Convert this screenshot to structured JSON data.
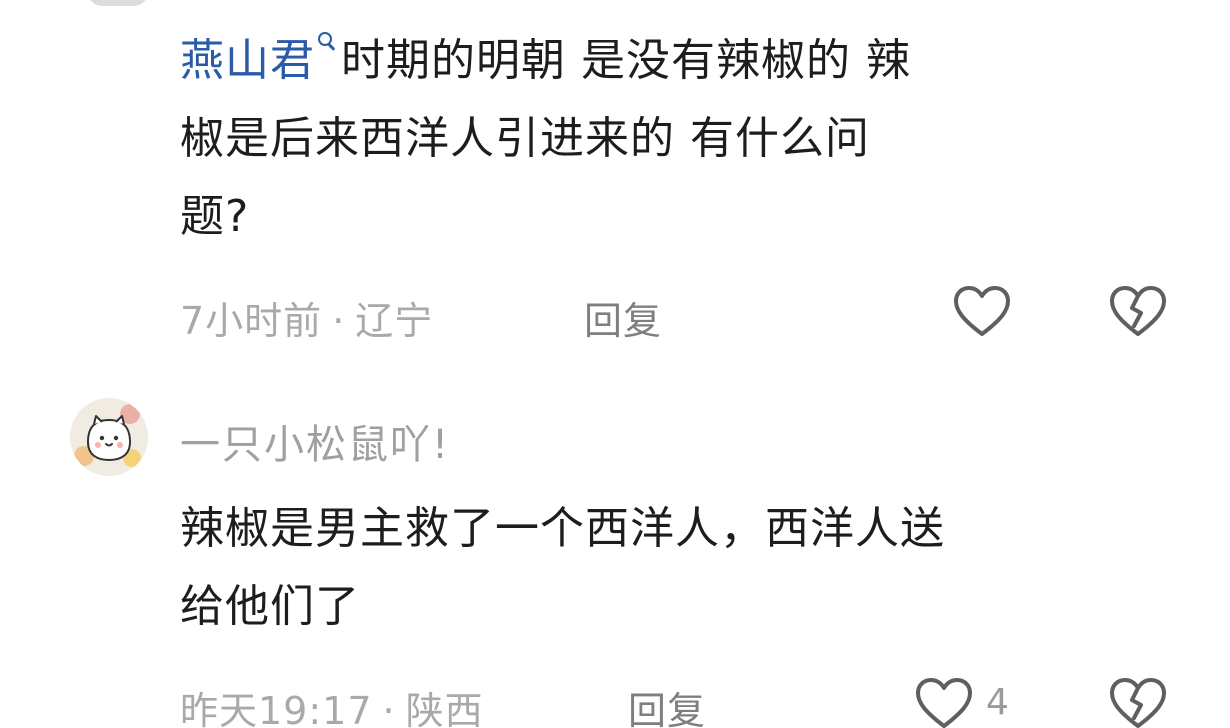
{
  "comment1": {
    "mention": "燕山君",
    "text_line1": "时期的明朝 是没有辣椒的 辣",
    "text_line2": "椒是后来西洋人引进来的 有什么问",
    "text_line3": "题?",
    "time": "7小时前",
    "location": "辽宁",
    "separator": "·",
    "reply_label": "回复",
    "like_icon": "heart-outline-icon",
    "dislike_icon": "broken-heart-icon"
  },
  "comment2": {
    "avatar_icon": "cartoon-cat-avatar",
    "username": "一只小松鼠吖!",
    "text_line1": "辣椒是男主救了一个西洋人，西洋人送",
    "text_line2": "给他们了",
    "time": "昨天19:17",
    "location": "陕西",
    "separator": "·",
    "reply_label": "回复",
    "like_count": "4",
    "like_icon": "heart-outline-icon",
    "dislike_icon": "broken-heart-icon"
  },
  "colors": {
    "mention": "#2a5aa8",
    "meta": "#a9a9a9",
    "body": "#1d1d1d"
  }
}
